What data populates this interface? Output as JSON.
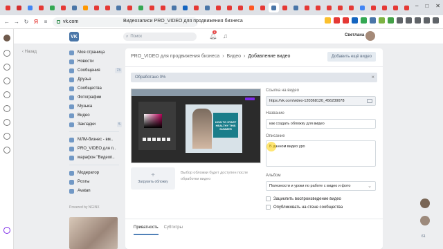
{
  "browser": {
    "address": "vk.com",
    "page_title": "Видеозаписи PRO_VIDEO для продвижения бизнеса",
    "window_controls": [
      "–",
      "□",
      "✕"
    ],
    "tab_colors": [
      "#e53935",
      "#d32f2f",
      "#4285f4",
      "#e53935",
      "#34a853",
      "#e53935",
      "#4a76a8",
      "#ff9800",
      "#e53935",
      "#e53935",
      "#4a76a8",
      "#e53935",
      "#34a853",
      "#e53935",
      "#e53935",
      "#4a76a8",
      "#1565c0",
      "#e53935",
      "#4a76a8",
      "#e53935",
      "#e53935",
      "#e53935",
      "#ff5722",
      "#e53935",
      "#4a76a8",
      "#e53935",
      "#4a76a8",
      "#e53935",
      "#e53935",
      "#e53935",
      "#e53935",
      "#e53935",
      "#4285f4",
      "#e53935",
      "#e53935",
      "#e53935",
      "#e53935"
    ],
    "ext_colors": [
      "#fbc02d",
      "#e53935",
      "#e53935",
      "#1565c0",
      "#34a853",
      "#4a76a8",
      "#7cb342",
      "#43a047",
      "#5f6368",
      "#5f6368",
      "#5f6368",
      "#5f6368",
      "#5f6368"
    ]
  },
  "header": {
    "search_placeholder": "Поиск",
    "notif_count": "8",
    "user_name": "Светлана",
    "logo_text": "VK"
  },
  "nav": {
    "back": "Назад"
  },
  "menu": {
    "items": [
      {
        "label": "Моя страница"
      },
      {
        "label": "Новости"
      },
      {
        "label": "Сообщения",
        "count": "73"
      },
      {
        "label": "Друзья"
      },
      {
        "label": "Сообщества"
      },
      {
        "label": "Фотографии"
      },
      {
        "label": "Музыка"
      },
      {
        "label": "Видео"
      },
      {
        "label": "Закладки",
        "count": "5"
      }
    ],
    "communities": [
      {
        "label": "МЛМ-бизнес - вм.."
      },
      {
        "label": "PRO_VIDEO для п.."
      },
      {
        "label": "марафон \"Видеоп.."
      }
    ],
    "extra": [
      {
        "label": "Модератор"
      },
      {
        "label": "Posты"
      },
      {
        "label": "Avatan"
      }
    ],
    "powered": "Powered by NGINX"
  },
  "card": {
    "breadcrumb": [
      "PRO_VIDEO для продвижения бизнеса",
      "Видео",
      "Добавление видео"
    ],
    "add_more_button": "Добавить ещё видео",
    "progress_text": "Обработано 0%",
    "upload_cover": "Загрузить обложку",
    "cover_note": "Выбор обложки будет доступен после обработки видео",
    "preview_text": "HOW TO START HEALTHY THIS SUMMER",
    "link_label": "Ссылка на видео",
    "link_value": "https://vk.com/video-120368120_456239078",
    "title_label": "Название",
    "title_value": "как создать обложку для видео",
    "desc_label": "Описание",
    "desc_value": "В данном видео уро",
    "album_label": "Альбом",
    "album_value": "Полезности и уроки по работе с видео и фото",
    "loop_label": "Зациклить воспроизведение видео",
    "publish_label": "Опубликовать на стене сообщества",
    "tabs": [
      "Приватность",
      "Субтитры"
    ]
  },
  "right": {
    "chat_count": "61"
  }
}
